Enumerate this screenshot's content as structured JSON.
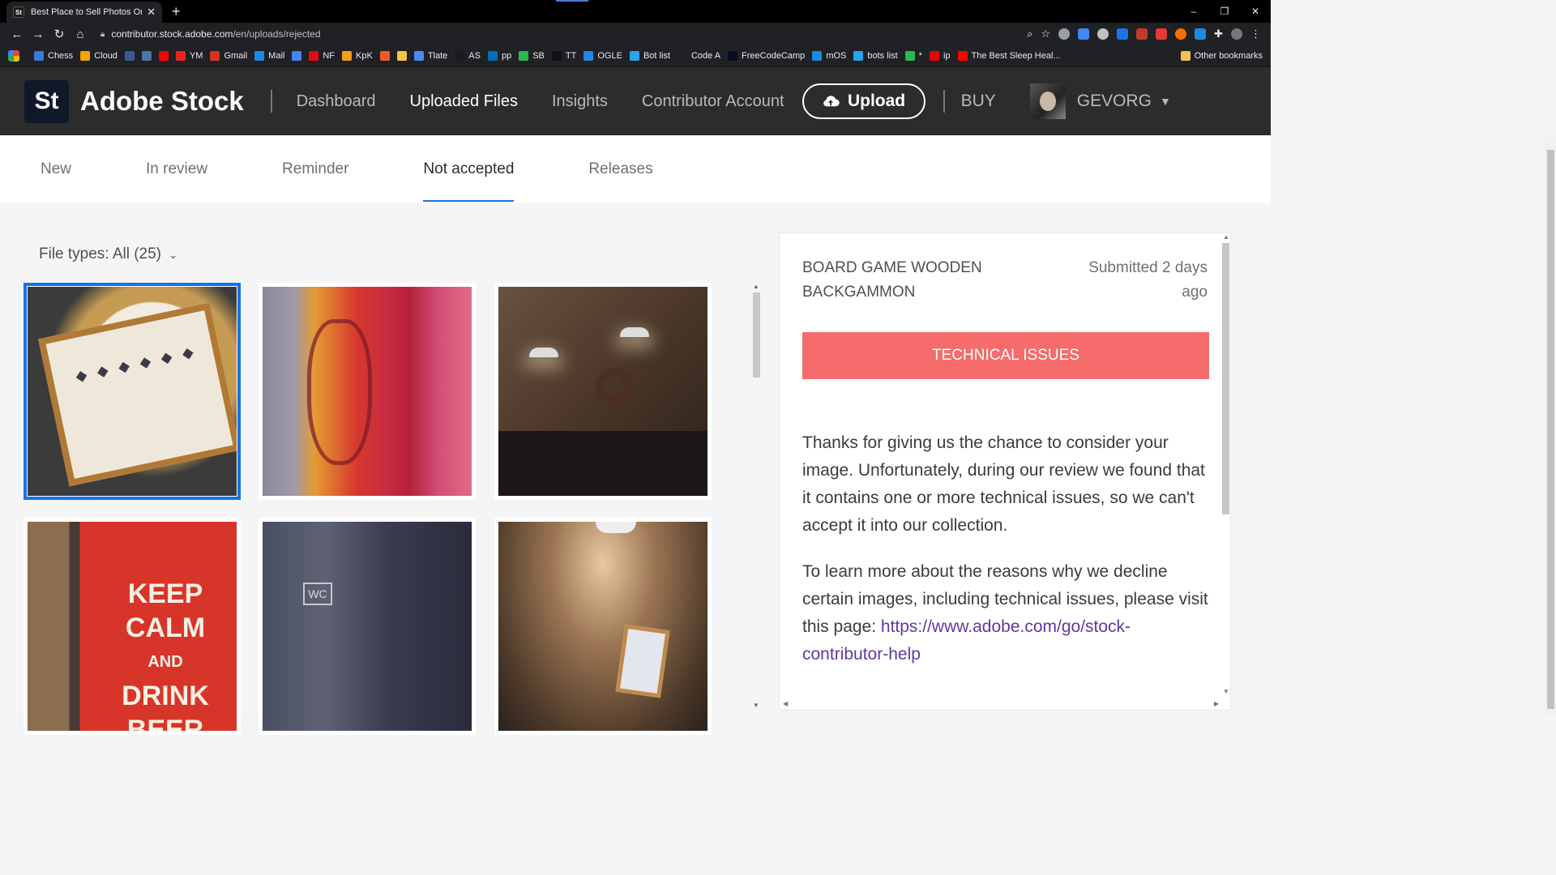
{
  "browser": {
    "tab_title": "Best Place to Sell Photos Online,",
    "tab_favicon": "St",
    "url_host": "contributor.stock.adobe.com",
    "url_path": "/en/uploads/rejected",
    "window_controls": [
      "–",
      "❐",
      "✕"
    ],
    "bookmarks": [
      {
        "label": "Chess",
        "color": "#3a7bd5"
      },
      {
        "label": "Cloud",
        "color": "#f4a300"
      },
      {
        "label": "",
        "color": "#3b5998"
      },
      {
        "label": "",
        "color": "#4a76a8"
      },
      {
        "label": "",
        "color": "#ff0000"
      },
      {
        "label": "YM",
        "color": "#e22"
      },
      {
        "label": "Gmail",
        "color": "#d93025"
      },
      {
        "label": "Mail",
        "color": "#1e88e5"
      },
      {
        "label": "",
        "color": "#4285f4"
      },
      {
        "label": "NF",
        "color": "#e50914"
      },
      {
        "label": "KpK",
        "color": "#f29d1f"
      },
      {
        "label": "",
        "color": "#f05a28"
      },
      {
        "label": "",
        "color": "#f6c343"
      },
      {
        "label": "Tlate",
        "color": "#4a8af4"
      },
      {
        "label": "AS",
        "color": "#1b1b1b"
      },
      {
        "label": "pp",
        "color": "#0070ba"
      },
      {
        "label": "SB",
        "color": "#2db84b"
      },
      {
        "label": "TT",
        "color": "#111111"
      },
      {
        "label": "OGLE",
        "color": "#1e88e5"
      },
      {
        "label": "Bot list",
        "color": "#2aa3ef"
      },
      {
        "label": "Code A",
        "color": "#202124"
      },
      {
        "label": "FreeCodeCamp",
        "color": "#0a0a23"
      },
      {
        "label": "mOS",
        "color": "#1e88e5"
      },
      {
        "label": "bots list",
        "color": "#2aa3ef"
      },
      {
        "label": "*",
        "color": "#2db84b"
      },
      {
        "label": "ip",
        "color": "#e00"
      },
      {
        "label": "The Best Sleep Heal...",
        "color": "#ff0000"
      }
    ],
    "other_bookmarks": "Other bookmarks"
  },
  "header": {
    "logo_badge": "St",
    "logo_text": "Adobe Stock",
    "nav": [
      {
        "label": "Dashboard",
        "active": false
      },
      {
        "label": "Uploaded Files",
        "active": true
      },
      {
        "label": "Insights",
        "active": false
      },
      {
        "label": "Contributor Account",
        "active": false
      }
    ],
    "upload_label": "Upload",
    "buy_label": "BUY",
    "user_name": "GEVORG"
  },
  "subtabs": [
    {
      "label": "New",
      "active": false
    },
    {
      "label": "In review",
      "active": false
    },
    {
      "label": "Reminder",
      "active": false
    },
    {
      "label": "Not accepted",
      "active": true
    },
    {
      "label": "Releases",
      "active": false
    }
  ],
  "filter": {
    "file_types_label": "File types: All (25)"
  },
  "thumbnails": [
    {
      "name": "thumb-backgammon",
      "selected": true
    },
    {
      "name": "thumb-guitar",
      "selected": false
    },
    {
      "name": "thumb-lamps",
      "selected": false
    },
    {
      "name": "thumb-keep-calm",
      "selected": false,
      "text_lines": [
        "KEEP",
        "CALM",
        "AND",
        "DRINK",
        "BEER"
      ]
    },
    {
      "name": "thumb-wc-door",
      "selected": false,
      "text": "WC"
    },
    {
      "name": "thumb-portrait",
      "selected": false
    }
  ],
  "details": {
    "title": "BOARD GAME WOODEN BACKGAMMON",
    "submitted": "Submitted 2 days ago",
    "reason": "TECHNICAL ISSUES",
    "paragraph1": "Thanks for giving us the chance to consider your image. Unfortunately, during our review we found that it contains one or more technical issues, so we can't accept it into our collection.",
    "paragraph2_prefix": "To learn more about the reasons why we decline certain images, including technical issues, please visit this page: ",
    "help_link": "https://www.adobe.com/go/stock-contributor-help"
  },
  "colors": {
    "accent": "#1473e6",
    "reason_bg": "#f66b6b",
    "link": "#5d3aa0",
    "header_bg": "#2c2c2c"
  }
}
